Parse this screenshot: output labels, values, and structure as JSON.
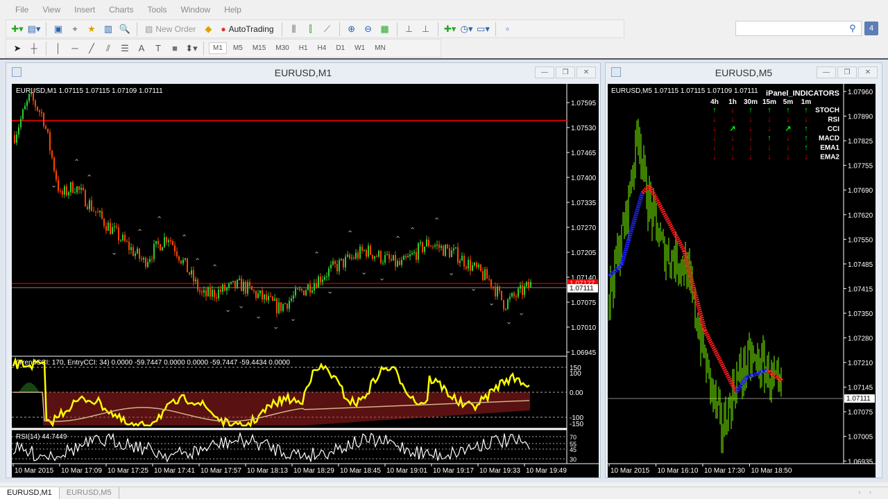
{
  "menu": [
    "File",
    "View",
    "Insert",
    "Charts",
    "Tools",
    "Window",
    "Help"
  ],
  "toolbar": {
    "new_order": "New Order",
    "autotrading": "AutoTrading",
    "search_placeholder": "",
    "notifications": "4"
  },
  "timeframes": [
    "M1",
    "M5",
    "M15",
    "M30",
    "H1",
    "H4",
    "D1",
    "W1",
    "MN"
  ],
  "active_timeframe": "M1",
  "left_window": {
    "title": "EURUSD,M1",
    "info": "EURUSD,M1  1.07115 1.07115 1.07109 1.07111",
    "price_axis": [
      "1.07595",
      "1.07530",
      "1.07465",
      "1.07400",
      "1.07335",
      "1.07270",
      "1.07205",
      "1.07140",
      "1.07075",
      "1.07010",
      "1.06945"
    ],
    "bid_label": "1.07111",
    "ask_label": "1.07127",
    "cci_label": "(TrendCCI: 170, EntryCCI: 34)  0.0000 -59.7447 0.0000 0.0000 -59.7447 -59.4434 0.0000",
    "cci_axis": [
      "150",
      "100",
      "0.00",
      "-100",
      "-150"
    ],
    "rsi_label": "RSI(14) 44.7449",
    "rsi_axis": [
      "70",
      "55",
      "45",
      "30"
    ],
    "time_axis": [
      "10 Mar 2015",
      "10 Mar 17:09",
      "10 Mar 17:25",
      "10 Mar 17:41",
      "10 Mar 17:57",
      "10 Mar 18:13",
      "10 Mar 18:29",
      "10 Mar 18:45",
      "10 Mar 19:01",
      "10 Mar 19:17",
      "10 Mar 19:33",
      "10 Mar 19:49"
    ]
  },
  "right_window": {
    "title": "EURUSD,M5",
    "info": "EURUSD,M5  1.07115 1.07115 1.07109 1.07111",
    "price_axis": [
      "1.07960",
      "1.07890",
      "1.07825",
      "1.07755",
      "1.07690",
      "1.07620",
      "1.07550",
      "1.07485",
      "1.07415",
      "1.07350",
      "1.07280",
      "1.07210",
      "1.07145",
      "1.07075",
      "1.07005",
      "1.06935"
    ],
    "bid_label": "1.07111",
    "time_axis": [
      "10 Mar 2015",
      "10 Mar 16:10",
      "10 Mar 17:30",
      "10 Mar 18:50"
    ],
    "panel": {
      "title": "iPanel_INDICATORS",
      "columns": [
        "4h",
        "1h",
        "30m",
        "15m",
        "5m",
        "1m"
      ],
      "rows": [
        {
          "name": "STOCH",
          "signals": [
            "up",
            "down",
            "up",
            "up",
            "up",
            "up"
          ]
        },
        {
          "name": "RSI",
          "signals": [
            "down",
            "down",
            "down",
            "down",
            "down",
            "down"
          ]
        },
        {
          "name": "CCI",
          "signals": [
            "down",
            "up-right",
            "down",
            "down",
            "up-right",
            "up"
          ]
        },
        {
          "name": "MACD",
          "signals": [
            "down",
            "down",
            "down",
            "up",
            "down",
            "up"
          ]
        },
        {
          "name": "EMA1",
          "signals": [
            "down",
            "down",
            "down",
            "down",
            "down",
            "up"
          ]
        },
        {
          "name": "EMA2",
          "signals": [
            "down",
            "down",
            "down",
            "down",
            "down",
            "down"
          ]
        }
      ]
    }
  },
  "tabs": [
    "EURUSD,M1",
    "EURUSD,M5"
  ],
  "colors": {
    "bull": "#32cd32",
    "bear": "#ff4500",
    "up": "#00ff00",
    "down": "#ff0000",
    "cci": "#ffff00",
    "hist": "#b22222"
  }
}
